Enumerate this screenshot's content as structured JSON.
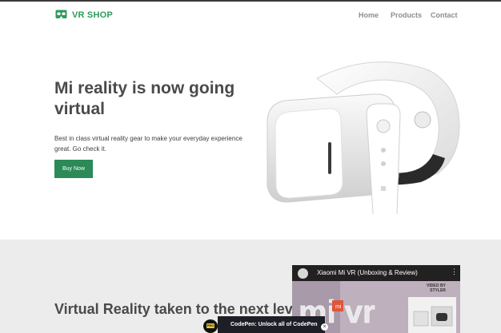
{
  "nav": {
    "brand": "VR SHOP",
    "links": [
      "Home",
      "Products",
      "Contact"
    ]
  },
  "hero": {
    "title": "Mi reality is now going virtual",
    "description": "Best in class virtual reality gear to make your everyday experience great. Go check it.",
    "button_label": "Buy Now"
  },
  "section2": {
    "title": "Virtual Reality taken to the next level",
    "description": ""
  },
  "video": {
    "title": "Xiaomi Mi VR (Unboxing & Review)",
    "channel_overlay": "VIDEO BY\nSTYLER",
    "graphic_text": "mi vr"
  },
  "codepen": {
    "badge": "PRO",
    "text": "CodePen: Unlock all of CodePen",
    "close": "×"
  },
  "colors": {
    "brand_green": "#2d9a5c",
    "button_green": "#2b8a57",
    "section_gray": "#ececec"
  }
}
